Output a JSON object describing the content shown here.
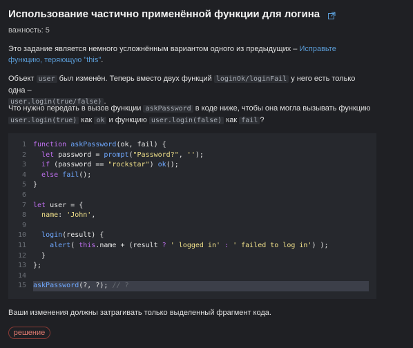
{
  "title": "Использование частично применённой функции для логина",
  "importance": "важность: 5",
  "p1": {
    "text": "Это задание является немного усложнённым вариантом одного из предыдущих – ",
    "link": "Исправьте функцию, теряющую \"this\"",
    "end": "."
  },
  "p2": {
    "t1": "Объект ",
    "c1": "user",
    "t2": " был изменён. Теперь вместо двух функций ",
    "c2": "loginOk/loginFail",
    "t3": " у него есть только одна – ",
    "c3": "user.login(true/false)",
    "t4": "."
  },
  "p3": {
    "t1": "Что нужно передать в вызов функции ",
    "c1": "askPassword",
    "t2": " в коде ниже, чтобы она могла вызывать функцию ",
    "c2": "user.login(true)",
    "t3": " как ",
    "c3": "ok",
    "t4": " и функцию ",
    "c4": "user.login(false)",
    "t5": " как ",
    "c5": "fail",
    "t6": "?"
  },
  "code": {
    "lines": [
      "1",
      "2",
      "3",
      "4",
      "5",
      "6",
      "7",
      "8",
      "9",
      "10",
      "11",
      "12",
      "13",
      "14",
      "15"
    ],
    "l1": {
      "kw": "function",
      "fn": "askPassword",
      "rest": "(ok, fail) {"
    },
    "l2": {
      "pre": "  ",
      "kw": "let",
      "mid": " password = ",
      "fn": "prompt",
      "p1": "(",
      "s1": "\"Password?\"",
      "p2": ", ",
      "s2": "''",
      "p3": ");"
    },
    "l3": {
      "pre": "  ",
      "kw": "if",
      "mid": " (password == ",
      "s1": "\"rockstar\"",
      "mid2": ") ",
      "fn": "ok",
      "end": "();"
    },
    "l4": {
      "pre": "  ",
      "kw": "else",
      "mid": " ",
      "fn": "fail",
      "end": "();"
    },
    "l5": {
      "text": "}"
    },
    "l7": {
      "kw": "let",
      "rest": " user = {"
    },
    "l8": {
      "pre": "  ",
      "key": "name",
      "mid": ": ",
      "s1": "'John'",
      "end": ","
    },
    "l10": {
      "pre": "  ",
      "fn": "login",
      "rest": "(result) {"
    },
    "l11": {
      "pre": "    ",
      "fn": "alert",
      "p1": "( ",
      "kw": "this",
      "mid": ".name + (result ",
      "op1": "?",
      "sp1": " ",
      "s1": "' logged in'",
      "sp2": " ",
      "op2": ":",
      "sp3": " ",
      "s2": "' failed to log in'",
      "end": ") );"
    },
    "l12": {
      "text": "  }"
    },
    "l13": {
      "text": "};"
    },
    "l15": {
      "fn": "askPassword",
      "rest": "(?, ?); ",
      "comment": "// ?"
    }
  },
  "note": "Ваши изменения должны затрагивать только выделенный фрагмент кода.",
  "solution_label": "решение",
  "colors": {
    "background": "#1f2024",
    "link": "#5a9bd5",
    "keyword": "#c070f0",
    "function": "#6fa8ff",
    "string": "#f0e08a",
    "button": "#e27a70"
  }
}
